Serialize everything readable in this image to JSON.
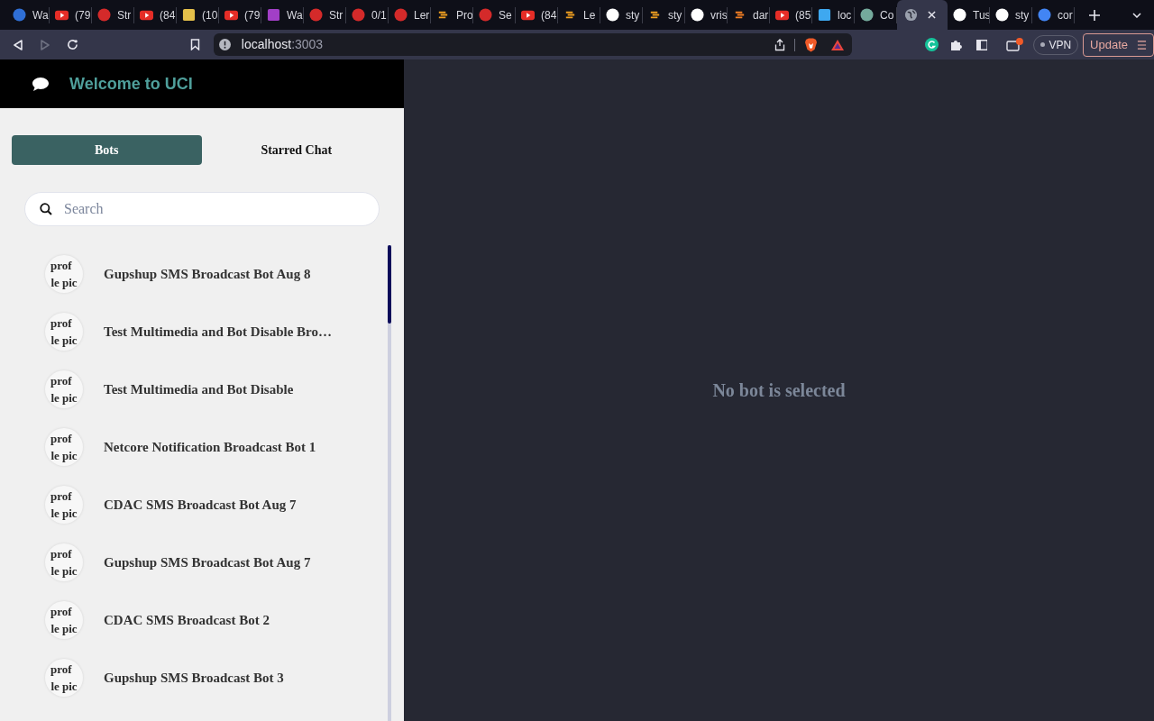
{
  "browser_tabs": [
    {
      "title": "Wa",
      "kind": "circle",
      "color": "#2f6fd6",
      "selected": false
    },
    {
      "title": "(79",
      "kind": "play",
      "color": "#e52d27",
      "selected": false
    },
    {
      "title": "Str",
      "kind": "circle",
      "color": "#d42a2a",
      "selected": false
    },
    {
      "title": "(84",
      "kind": "play",
      "color": "#e52d27",
      "selected": false
    },
    {
      "title": "(10",
      "kind": "square",
      "color": "#e5c04a",
      "selected": false
    },
    {
      "title": "(79",
      "kind": "play",
      "color": "#e52d27",
      "selected": false
    },
    {
      "title": "Wa",
      "kind": "square",
      "color": "#a23fc7",
      "selected": false
    },
    {
      "title": "Str",
      "kind": "circle",
      "color": "#d42a2a",
      "selected": false
    },
    {
      "title": "0/1",
      "kind": "circle",
      "color": "#d42a2a",
      "selected": false
    },
    {
      "title": "Ler",
      "kind": "circle",
      "color": "#d42a2a",
      "selected": false
    },
    {
      "title": "Pro",
      "kind": "bars",
      "color": "#f0a020",
      "selected": false
    },
    {
      "title": "Se",
      "kind": "circle",
      "color": "#d42a2a",
      "selected": false
    },
    {
      "title": "(84",
      "kind": "play",
      "color": "#e52d27",
      "selected": false
    },
    {
      "title": "Le",
      "kind": "bars",
      "color": "#f0a020",
      "selected": false
    },
    {
      "title": "sty",
      "kind": "circle",
      "color": "#ffffff",
      "selected": false
    },
    {
      "title": "sty",
      "kind": "bars",
      "color": "#f0a020",
      "selected": false
    },
    {
      "title": "vris",
      "kind": "circle",
      "color": "#ffffff",
      "selected": false
    },
    {
      "title": "dar",
      "kind": "bars",
      "color": "#f48024",
      "selected": false
    },
    {
      "title": "(85",
      "kind": "play",
      "color": "#e52d27",
      "selected": false
    },
    {
      "title": "loc",
      "kind": "square",
      "color": "#3ea8f0",
      "selected": false
    },
    {
      "title": "Co",
      "kind": "circle",
      "color": "#74aa9c",
      "selected": false
    },
    {
      "kind": "globe",
      "color": "#9aa0ad",
      "selected": true
    },
    {
      "title": "Tus",
      "kind": "circle",
      "color": "#ffffff",
      "selected": false
    },
    {
      "title": "sty",
      "kind": "circle",
      "color": "#ffffff",
      "selected": false
    },
    {
      "title": "cor",
      "kind": "circle",
      "color": "#4285f4",
      "selected": false
    }
  ],
  "address_bar": {
    "host": "localhost",
    "port": ":3003"
  },
  "vpn_label": "VPN",
  "update_button": "Update",
  "app_header": {
    "title": "Welcome to UCI"
  },
  "tabs": [
    {
      "label": "Bots",
      "selected": true
    },
    {
      "label": "Starred Chat",
      "selected": false
    }
  ],
  "search": {
    "placeholder": "Search"
  },
  "bots": [
    {
      "name": "Gupshup SMS Broadcast Bot Aug 8",
      "avatar_alt": [
        "prof",
        "le pic"
      ]
    },
    {
      "name": "Test Multimedia and Bot Disable Bro…",
      "avatar_alt": [
        "prof",
        "le pic"
      ]
    },
    {
      "name": "Test Multimedia and Bot Disable",
      "avatar_alt": [
        "prof",
        "le pic"
      ]
    },
    {
      "name": "Netcore Notification Broadcast Bot 1",
      "avatar_alt": [
        "prof",
        "le pic"
      ]
    },
    {
      "name": "CDAC SMS Broadcast Bot Aug 7",
      "avatar_alt": [
        "prof",
        "le pic"
      ]
    },
    {
      "name": "Gupshup SMS Broadcast Bot Aug 7",
      "avatar_alt": [
        "prof",
        "le pic"
      ]
    },
    {
      "name": "CDAC SMS Broadcast Bot 2",
      "avatar_alt": [
        "prof",
        "le pic"
      ]
    },
    {
      "name": "Gupshup SMS Broadcast Bot 3",
      "avatar_alt": [
        "prof",
        "le pic"
      ]
    }
  ],
  "empty_state": "No bot is selected"
}
